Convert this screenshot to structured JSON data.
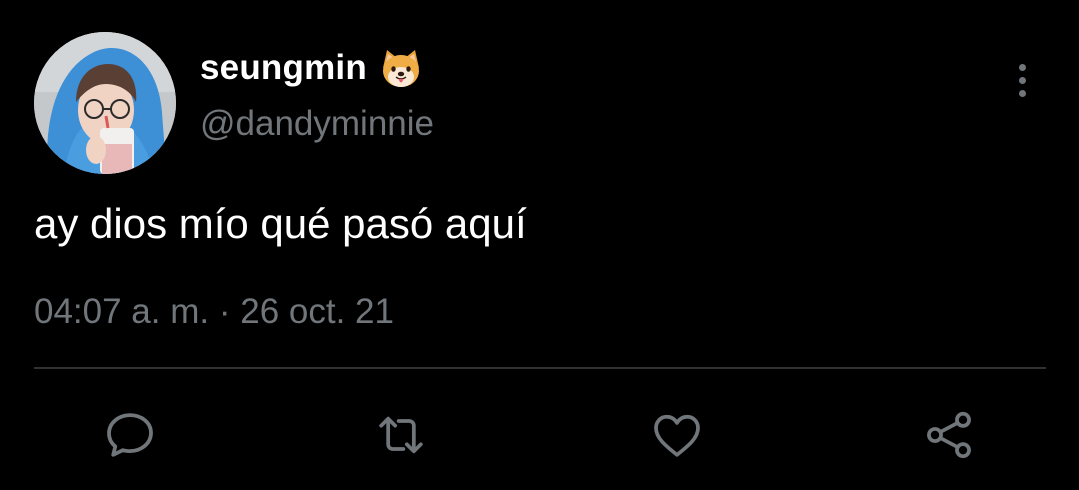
{
  "tweet": {
    "display_name": "seungmin",
    "display_name_emoji": "dog-face-emoji",
    "handle": "@dandyminnie",
    "text": "ay dios mío qué pasó aquí",
    "time": "04:07 a. m.",
    "separator": "·",
    "date": "26 oct. 21"
  },
  "actions": {
    "icons": [
      "reply-icon",
      "retweet-icon",
      "like-icon",
      "share-icon"
    ]
  },
  "colors": {
    "background": "#000000",
    "primary_text": "#ffffff",
    "secondary_text": "#71767b",
    "divider": "#2f3336",
    "avatar_hoodie": "#3d8fd6"
  }
}
